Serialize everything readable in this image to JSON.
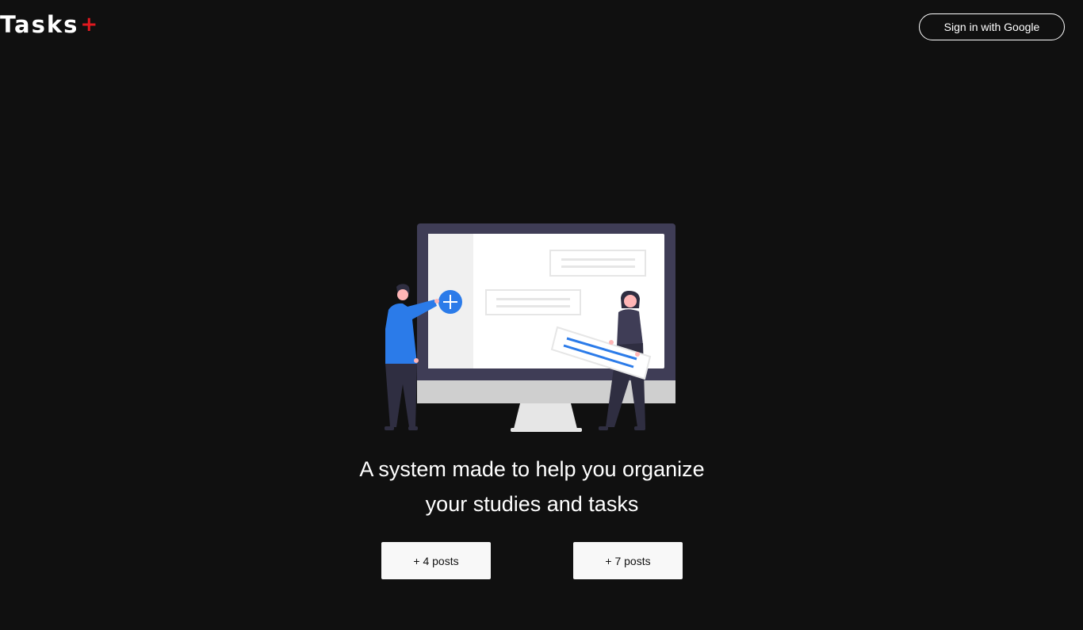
{
  "header": {
    "logo_text": "Tasks",
    "logo_mark": "+",
    "signin_label": "Sign in with Google"
  },
  "hero": {
    "illustration_icon": "people-at-monitor-illustration",
    "tagline_line1": "A system made to help you organize",
    "tagline_line2": "your studies and tasks"
  },
  "stats": [
    {
      "label": "+ 4 posts"
    },
    {
      "label": "+ 7 posts"
    }
  ],
  "colors": {
    "background": "#101010",
    "text": "#ffffff",
    "logo_accent": "#e0191f",
    "illustration_blue": "#2b7be9",
    "monitor_frame": "#3f3d56"
  }
}
